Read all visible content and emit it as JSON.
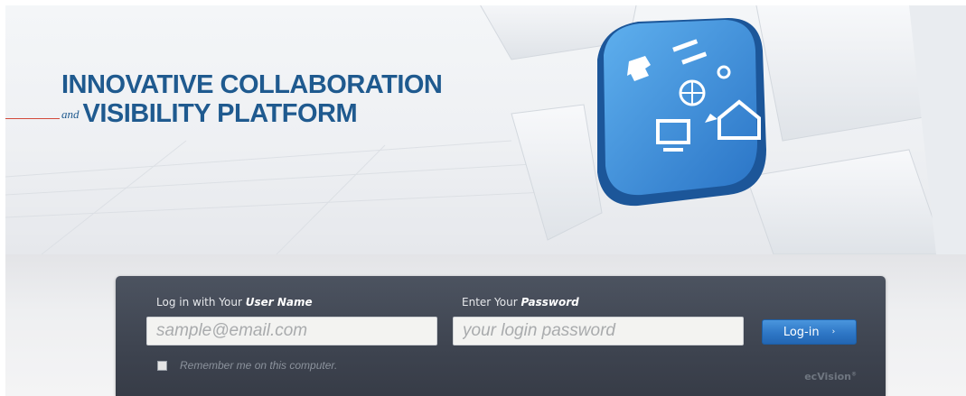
{
  "hero": {
    "headline_line1": "INNOVATIVE COLLABORATION",
    "headline_and": "and",
    "headline_line2": "VISIBILITY PLATFORM",
    "key_icon": "collaboration-keyboard-key-icon"
  },
  "login": {
    "user_label_prefix": "Log in  with Your ",
    "user_label_emphasis": "User Name",
    "user_placeholder": "sample@email.com",
    "user_value": "",
    "pass_label_prefix": "Enter Your ",
    "pass_label_emphasis": "Password",
    "pass_placeholder": "your login password",
    "pass_value": "",
    "button_label": "Log-in",
    "button_arrow": "›",
    "remember_label": "Remember me on this computer.",
    "remember_checked": false
  },
  "brand": {
    "name": "ecVision",
    "mark": "®"
  },
  "colors": {
    "headline": "#1f5a8f",
    "panel": "#3e4450",
    "button": "#2e77c6",
    "accent_rule": "#d24a3a"
  }
}
